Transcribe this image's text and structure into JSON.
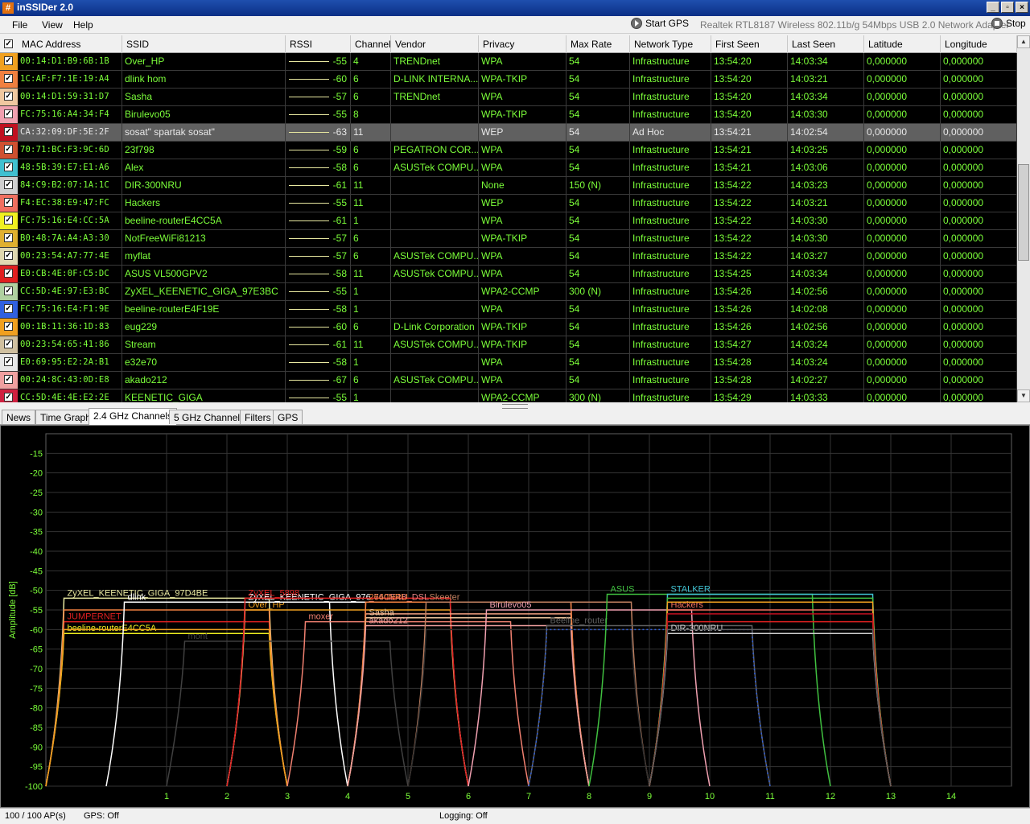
{
  "window": {
    "title": "inSSIDer 2.0",
    "icon": "#"
  },
  "menu": {
    "items": [
      "File",
      "View",
      "Help"
    ]
  },
  "toolbar": {
    "start_gps": "Start GPS",
    "adapter": "Realtek RTL8187 Wireless 802.11b/g 54Mbps USB 2.0 Network Adapter",
    "stop": "Stop"
  },
  "table": {
    "columns": [
      "MAC Address",
      "SSID",
      "RSSI",
      "Channel",
      "Vendor",
      "Privacy",
      "Max Rate",
      "Network Type",
      "First Seen",
      "Last Seen",
      "Latitude",
      "Longitude"
    ],
    "rows": [
      {
        "color": "#f0a020",
        "mac": "00:14:D1:B9:6B:1B",
        "ssid": "Over_HP",
        "rssi": "-55",
        "channel": "4",
        "vendor": "TRENDnet",
        "privacy": "WPA",
        "rate": "54",
        "type": "Infrastructure",
        "first": "13:54:20",
        "last": "14:03:34",
        "lat": "0,000000",
        "lon": "0,000000"
      },
      {
        "color": "#f08040",
        "mac": "1C:AF:F7:1E:19:A4",
        "ssid": "dlink hom",
        "rssi": "-60",
        "channel": "6",
        "vendor": "D-LINK INTERNA...",
        "privacy": "WPA-TKIP",
        "rate": "54",
        "type": "Infrastructure",
        "first": "13:54:20",
        "last": "14:03:21",
        "lat": "0,000000",
        "lon": "0,000000"
      },
      {
        "color": "#f0c8a0",
        "mac": "00:14:D1:59:31:D7",
        "ssid": "Sasha",
        "rssi": "-57",
        "channel": "6",
        "vendor": "TRENDnet",
        "privacy": "WPA",
        "rate": "54",
        "type": "Infrastructure",
        "first": "13:54:20",
        "last": "14:03:34",
        "lat": "0,000000",
        "lon": "0,000000"
      },
      {
        "color": "#f0a0b0",
        "mac": "FC:75:16:A4:34:F4",
        "ssid": "Birulevo05",
        "rssi": "-55",
        "channel": "8",
        "vendor": "",
        "privacy": "WPA-TKIP",
        "rate": "54",
        "type": "Infrastructure",
        "first": "13:54:20",
        "last": "14:03:30",
        "lat": "0,000000",
        "lon": "0,000000"
      },
      {
        "color": "#c01020",
        "mac": "CA:32:09:DF:5E:2F",
        "ssid": "sosat\" spartak sosat\"",
        "rssi": "-63",
        "channel": "11",
        "vendor": "",
        "privacy": "WEP",
        "rate": "54",
        "type": "Ad Hoc",
        "first": "13:54:21",
        "last": "14:02:54",
        "lat": "0,000000",
        "lon": "0,000000"
      },
      {
        "color": "#d05030",
        "mac": "70:71:BC:F3:9C:6D",
        "ssid": "23f798",
        "rssi": "-59",
        "channel": "6",
        "vendor": "PEGATRON COR...",
        "privacy": "WPA",
        "rate": "54",
        "type": "Infrastructure",
        "first": "13:54:21",
        "last": "14:03:25",
        "lat": "0,000000",
        "lon": "0,000000"
      },
      {
        "color": "#40c0d0",
        "mac": "48:5B:39:E7:E1:A6",
        "ssid": "Alex",
        "rssi": "-58",
        "channel": "6",
        "vendor": "ASUSTek COMPU...",
        "privacy": "WPA",
        "rate": "54",
        "type": "Infrastructure",
        "first": "13:54:21",
        "last": "14:03:06",
        "lat": "0,000000",
        "lon": "0,000000"
      },
      {
        "color": "#d0d0d0",
        "mac": "84:C9:B2:07:1A:1C",
        "ssid": "DIR-300NRU",
        "rssi": "-61",
        "channel": "11",
        "vendor": "",
        "privacy": "None",
        "rate": "150 (N)",
        "type": "Infrastructure",
        "first": "13:54:22",
        "last": "14:03:23",
        "lat": "0,000000",
        "lon": "0,000000"
      },
      {
        "color": "#f07060",
        "mac": "F4:EC:38:E9:47:FC",
        "ssid": "Hackers",
        "rssi": "-55",
        "channel": "11",
        "vendor": "",
        "privacy": "WEP",
        "rate": "54",
        "type": "Infrastructure",
        "first": "13:54:22",
        "last": "14:03:21",
        "lat": "0,000000",
        "lon": "0,000000"
      },
      {
        "color": "#f0f020",
        "mac": "FC:75:16:E4:CC:5A",
        "ssid": "beeline-routerE4CC5A",
        "rssi": "-61",
        "channel": "1",
        "vendor": "",
        "privacy": "WPA",
        "rate": "54",
        "type": "Infrastructure",
        "first": "13:54:22",
        "last": "14:03:30",
        "lat": "0,000000",
        "lon": "0,000000"
      },
      {
        "color": "#e0b030",
        "mac": "B0:48:7A:A4:A3:30",
        "ssid": "NotFreeWiFi81213",
        "rssi": "-57",
        "channel": "6",
        "vendor": "",
        "privacy": "WPA-TKIP",
        "rate": "54",
        "type": "Infrastructure",
        "first": "13:54:22",
        "last": "14:03:30",
        "lat": "0,000000",
        "lon": "0,000000"
      },
      {
        "color": "#e0d8b0",
        "mac": "00:23:54:A7:77:4E",
        "ssid": "myflat",
        "rssi": "-57",
        "channel": "6",
        "vendor": "ASUSTek COMPU...",
        "privacy": "WPA",
        "rate": "54",
        "type": "Infrastructure",
        "first": "13:54:22",
        "last": "14:03:27",
        "lat": "0,000000",
        "lon": "0,000000"
      },
      {
        "color": "#e02020",
        "mac": "E0:CB:4E:0F:C5:DC",
        "ssid": "ASUS VL500GPV2",
        "rssi": "-58",
        "channel": "11",
        "vendor": "ASUSTek COMPU...",
        "privacy": "WPA",
        "rate": "54",
        "type": "Infrastructure",
        "first": "13:54:25",
        "last": "14:03:34",
        "lat": "0,000000",
        "lon": "0,000000"
      },
      {
        "color": "#b0d0a0",
        "mac": "CC:5D:4E:97:E3:BC",
        "ssid": "ZyXEL_KEENETIC_GIGA_97E3BC",
        "rssi": "-55",
        "channel": "1",
        "vendor": "",
        "privacy": "WPA2-CCMP",
        "rate": "300 (N)",
        "type": "Infrastructure",
        "first": "13:54:26",
        "last": "14:02:56",
        "lat": "0,000000",
        "lon": "0,000000"
      },
      {
        "color": "#3060e0",
        "mac": "FC:75:16:E4:F1:9E",
        "ssid": "beeline-routerE4F19E",
        "rssi": "-58",
        "channel": "1",
        "vendor": "",
        "privacy": "WPA",
        "rate": "54",
        "type": "Infrastructure",
        "first": "13:54:26",
        "last": "14:02:08",
        "lat": "0,000000",
        "lon": "0,000000"
      },
      {
        "color": "#f0a020",
        "mac": "00:1B:11:36:1D:83",
        "ssid": "eug229",
        "rssi": "-60",
        "channel": "6",
        "vendor": "D-Link Corporation",
        "privacy": "WPA-TKIP",
        "rate": "54",
        "type": "Infrastructure",
        "first": "13:54:26",
        "last": "14:02:56",
        "lat": "0,000000",
        "lon": "0,000000"
      },
      {
        "color": "#d0c0a0",
        "mac": "00:23:54:65:41:86",
        "ssid": "Stream",
        "rssi": "-61",
        "channel": "11",
        "vendor": "ASUSTek COMPU...",
        "privacy": "WPA-TKIP",
        "rate": "54",
        "type": "Infrastructure",
        "first": "13:54:27",
        "last": "14:03:24",
        "lat": "0,000000",
        "lon": "0,000000"
      },
      {
        "color": "#e8e8e8",
        "mac": "E0:69:95:E2:2A:B1",
        "ssid": "e32e70",
        "rssi": "-58",
        "channel": "1",
        "vendor": "",
        "privacy": "WPA",
        "rate": "54",
        "type": "Infrastructure",
        "first": "13:54:28",
        "last": "14:03:24",
        "lat": "0,000000",
        "lon": "0,000000"
      },
      {
        "color": "#f0a0a0",
        "mac": "00:24:8C:43:0D:E8",
        "ssid": "akado212",
        "rssi": "-67",
        "channel": "6",
        "vendor": "ASUSTek COMPU...",
        "privacy": "WPA",
        "rate": "54",
        "type": "Infrastructure",
        "first": "13:54:28",
        "last": "14:02:27",
        "lat": "0,000000",
        "lon": "0,000000"
      },
      {
        "color": "#d02040",
        "mac": "CC:5D:4E:4E:E2:2E",
        "ssid": "KEENETIC_GIGA",
        "rssi": "-55",
        "channel": "1",
        "vendor": "",
        "privacy": "WPA2-CCMP",
        "rate": "300 (N)",
        "type": "Infrastructure",
        "first": "13:54:29",
        "last": "14:03:33",
        "lat": "0,000000",
        "lon": "0,000000"
      }
    ]
  },
  "tabs": [
    "News",
    "Time Graph",
    "2.4 GHz Channels",
    "5 GHz Channels",
    "Filters",
    "GPS"
  ],
  "active_tab": "2.4 GHz Channels",
  "chart_data": {
    "type": "line",
    "ylabel": "Amplitude [dB]",
    "yticks": [
      -15,
      -20,
      -25,
      -30,
      -35,
      -40,
      -45,
      -50,
      -55,
      -60,
      -65,
      -70,
      -75,
      -80,
      -85,
      -90,
      -95,
      -100
    ],
    "ylim": [
      -100,
      -10
    ],
    "xticks": [
      "1",
      "2",
      "3",
      "4",
      "5",
      "6",
      "7",
      "8",
      "9",
      "10",
      "11",
      "12",
      "13",
      "14"
    ],
    "xlim": [
      -1,
      15
    ],
    "series": [
      {
        "name": "ZyXEL_KEENETIC_GIGA_97D4BE",
        "channel": 1,
        "level": -52,
        "color": "#e8e8a0"
      },
      {
        "name": "beeline-routerE4CC5A",
        "channel": 1,
        "level": -61,
        "color": "#f0f020"
      },
      {
        "name": "JUMPERNET",
        "channel": 1,
        "level": -58,
        "color": "#e02020"
      },
      {
        "name": "",
        "channel": 1,
        "level": -55,
        "color": "#f08040"
      },
      {
        "name": "",
        "channel": 1,
        "level": -60,
        "color": "#f0a020"
      },
      {
        "name": "dlink",
        "channel": 2,
        "level": -53,
        "color": "#ffffff"
      },
      {
        "name": "mont",
        "channel": 3,
        "level": -63,
        "color": "#404040"
      },
      {
        "name": "Over_HP",
        "channel": 4,
        "level": -55,
        "color": "#f0a020"
      },
      {
        "name": "ZyXEL_KEENETIC_GIGA_976",
        "channel": 4,
        "level": -53,
        "color": "#ffffff"
      },
      {
        "name": "ZyXEL_5898",
        "channel": 4,
        "level": -52,
        "color": "#e02020"
      },
      {
        "name": "moxer",
        "channel": 5,
        "level": -58,
        "color": "#f08070"
      },
      {
        "name": "_76CE4B_DSL",
        "channel": 6,
        "level": -53,
        "color": "#e08080"
      },
      {
        "name": "",
        "channel": 6,
        "level": -56,
        "color": "#f0a080"
      },
      {
        "name": "",
        "channel": 6,
        "level": -57,
        "color": "#e0b030"
      },
      {
        "name": "Sasha",
        "channel": 6,
        "level": -57,
        "color": "#f0c8a0"
      },
      {
        "name": "2640NRU",
        "channel": 6,
        "level": -53,
        "color": "#f08040"
      },
      {
        "name": "akado212",
        "channel": 6,
        "level": -59,
        "color": "#f0a0a0"
      },
      {
        "name": "Skeeter",
        "channel": 7,
        "level": -53,
        "color": "#c08060"
      },
      {
        "name": "",
        "channel": 7,
        "level": -60,
        "color": "#303030"
      },
      {
        "name": "Birulevo05",
        "channel": 8,
        "level": -55,
        "color": "#f0a0b0"
      },
      {
        "name": "Beeline_router",
        "channel": 9,
        "level": -59,
        "color": "#606060"
      },
      {
        "name": "",
        "channel": 9,
        "level": -60,
        "color": "#3060e0"
      },
      {
        "name": "ASUS",
        "channel": 10,
        "level": -51,
        "color": "#40c040"
      },
      {
        "name": "STALKER",
        "channel": 11,
        "level": -51,
        "color": "#40c0d0"
      },
      {
        "name": "DIR-300NRU",
        "channel": 11,
        "level": -61,
        "color": "#d0d0d0"
      },
      {
        "name": "Hackers",
        "channel": 11,
        "level": -55,
        "color": "#f07060"
      },
      {
        "name": "",
        "channel": 11,
        "level": -58,
        "color": "#e02020"
      },
      {
        "name": "",
        "channel": 11,
        "level": -52,
        "color": "#40c040"
      },
      {
        "name": "",
        "channel": 11,
        "level": -53,
        "color": "#f0a020"
      },
      {
        "name": "",
        "channel": 11,
        "level": -56,
        "color": "#c01020"
      },
      {
        "name": "",
        "channel": 11,
        "level": -60,
        "color": "#606060"
      }
    ]
  },
  "status": {
    "aps": "100 / 100 AP(s)",
    "gps": "GPS: Off",
    "logging": "Logging: Off"
  }
}
